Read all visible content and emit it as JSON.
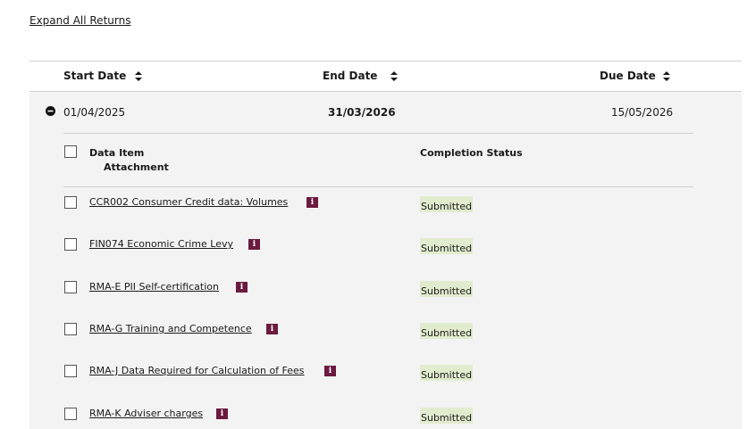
{
  "expand_link": "Expand All Returns",
  "table": {
    "headers": {
      "start": "Start Date",
      "end": "End Date",
      "due": "Due Date"
    },
    "return": {
      "start": "01/04/2025",
      "end": "31/03/2026",
      "due": "15/05/2026"
    },
    "items_header": {
      "data_item": "Data Item",
      "attachment": "Attachment",
      "status": "Completion Status"
    },
    "items": [
      {
        "name": "CCR002 Consumer Credit data: Volumes",
        "info": "i",
        "status": "Submitted"
      },
      {
        "name": "FIN074 Economic Crime Levy",
        "info": "i",
        "status": "Submitted"
      },
      {
        "name": "RMA-E PII Self-certification",
        "info": "i",
        "status": "Submitted"
      },
      {
        "name": "RMA-G Training and Competence",
        "info": "i",
        "status": "Submitted"
      },
      {
        "name": "RMA-J Data Required for Calculation of Fees",
        "info": "i",
        "status": "Submitted"
      },
      {
        "name": "RMA-K Adviser charges",
        "info": "i",
        "status": "Submitted"
      }
    ]
  },
  "colors": {
    "info_badge": "#6b1a40",
    "status_bg": "#e1eccf",
    "panel_bg": "#f3f3f3"
  }
}
